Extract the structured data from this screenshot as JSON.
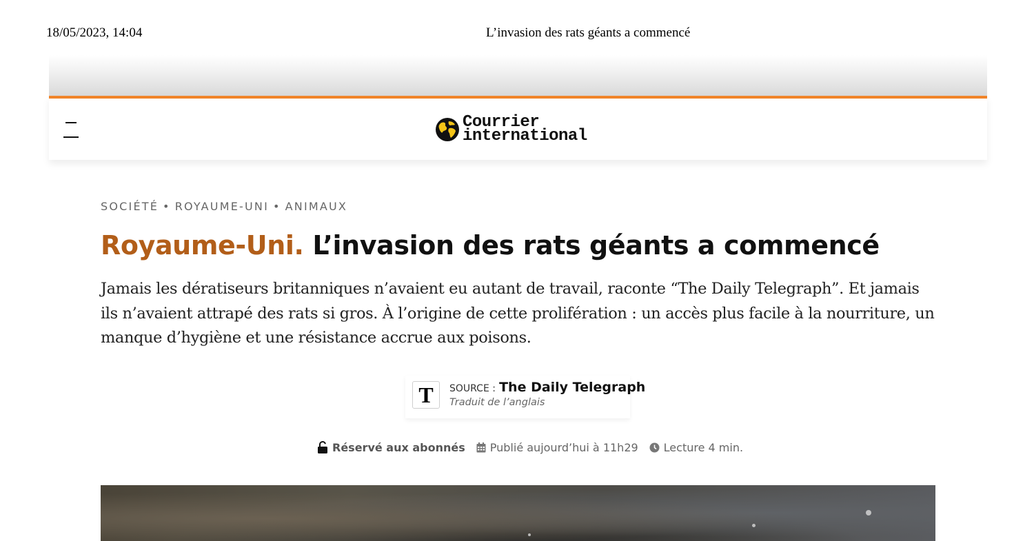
{
  "print_header": {
    "date": "18/05/2023, 14:04",
    "title": "L’invasion des rats géants a commencé"
  },
  "site": {
    "logo_line1": "Courrier",
    "logo_line2": "international",
    "accent_color": "#f08429"
  },
  "article": {
    "breadcrumb": [
      "SOCIÉTÉ",
      "ROYAUME-UNI",
      "ANIMAUX"
    ],
    "breadcrumb_sep": "•",
    "kicker": "Royaume-Uni.",
    "title": "L’invasion des rats géants a commencé",
    "lede": "Jamais les dératiseurs britanniques n’avaient eu autant de travail, raconte “The Daily Telegraph”. Et jamais ils n’avaient attrapé des rats si gros. À l’origine de cette prolifération : un accès plus facile à la nourriture, un manque d’hygiène et une résistance accrue aux poisons.",
    "kicker_color": "#b25e19"
  },
  "source": {
    "logo_letter": "T",
    "label": "SOURCE :",
    "name": "The Daily Telegraph",
    "translation": "Traduit de l’anglais"
  },
  "meta": {
    "subscribers": "Réservé aux abonnés",
    "published": "Publié aujourd’hui à 11h29",
    "reading_time": "Lecture 4 min."
  },
  "icons": {
    "menu": "menu-icon",
    "lock": "lock-icon",
    "calendar": "calendar-icon",
    "clock": "clock-icon",
    "globe": "globe-icon"
  }
}
